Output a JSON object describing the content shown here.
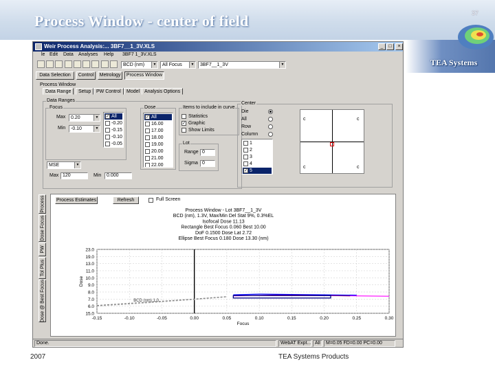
{
  "slide": {
    "title": "Process Window - center of field",
    "page_number": "37",
    "brand": "TEA Systems",
    "footer_year": "2007",
    "footer_company": "TEA Systems Products"
  },
  "window": {
    "title": "Weir Process Analysis:... 3BF7__1_3V.XLS",
    "menu": [
      "le",
      "Edit",
      "Data",
      "Analyses",
      "Help",
      "3BF7 1_3V.XLS"
    ],
    "toolbar": {
      "combo1": "BCD (nm)",
      "combo2": "All Focus",
      "combo3": "3BF7__1_3V"
    },
    "nav_buttons": [
      "Data Selection",
      "Control",
      "Metrology",
      "Process Window"
    ],
    "panel_label": "Process Window",
    "tabs": [
      "Data Range",
      "Setup",
      "PW Control",
      "Model",
      "Analysis Options"
    ],
    "data_ranges": {
      "label": "Data Ranges",
      "focus": {
        "label": "Focus",
        "max_label": "Max",
        "max_value": "0.20",
        "min_label": "Min",
        "min_value": "-0.10",
        "list": [
          "All",
          "-0.20",
          "-0.15",
          "-0.10",
          "-0.05"
        ]
      },
      "dose": {
        "label": "Dose",
        "list": [
          "All",
          "16.00",
          "17.00",
          "18.00",
          "19.00",
          "20.00",
          "21.00",
          "22.00"
        ]
      },
      "items": {
        "label": "Items to include in curve",
        "list": [
          "Statistics",
          "Graphic",
          "Show Limits"
        ]
      },
      "lot": {
        "label": "Lot",
        "range_label": "Range",
        "range_value": "0",
        "sigma_label": "Sigma",
        "sigma_value": "0"
      },
      "measure_combo": "MSE",
      "max_label": "Max",
      "max_value": "120",
      "min_label": "Min",
      "min_value": "0.000"
    },
    "center": {
      "label": "Center",
      "options": [
        "Die",
        "All",
        "Row",
        "Column"
      ],
      "list": [
        "1",
        "2",
        "3",
        "4",
        "5"
      ],
      "site_labels": [
        "c",
        "c",
        "c",
        "c"
      ]
    },
    "side_tabs": [
      "Process",
      "Dose Focus",
      "PW",
      "Tol Plus",
      "Dose @ Best Focus"
    ],
    "chart_toolbar": {
      "process_estimates": "Process Estimates",
      "refresh": "Refresh",
      "full_screen": "Full Screen"
    },
    "status": {
      "left": "Done.",
      "right1": "WebAT Expt...",
      "right2": "All",
      "right3": "M=0.05 FD=0.00 PC=0.00"
    }
  },
  "chart_data": {
    "type": "line",
    "title_lines": [
      "Process Window - Lot 3BF7__1_3V",
      "BCD (nm), 1.3V, Max/Min Del Stat 9%, 0.3%EL",
      "Isofocal Dose 11.13",
      "Rectangle Best Focus 0.060 Best 10.00",
      "DoF 0.1500 Dose Lat 2.72",
      "Ellipse Best Focus 0.180 Dose 13.30 (nm)"
    ],
    "xlabel": "Focus",
    "ylabel": "Dose",
    "x_ticks": [
      "-0.15",
      "-0.10",
      "-0.05",
      "0.00",
      "0.05",
      "0.10",
      "0.15",
      "0.20",
      "0.25",
      "0.30"
    ],
    "y_ticks": [
      "23.0",
      "19.0",
      "13.0",
      "11.0",
      "10.0",
      "9.0",
      "8.0",
      "7.0",
      "6.0",
      "15.0"
    ],
    "xlim": [
      -0.15,
      0.3
    ],
    "ylim": [
      5.0,
      23.0
    ],
    "series_annotation": "BCD (nm) 1.0",
    "series": [
      {
        "color": "#c0c0c0",
        "x": [
          -0.15,
          -0.1,
          -0.05,
          0.0,
          0.05
        ],
        "y": [
          7.0,
          7.6,
          8.2,
          8.9,
          9.6
        ]
      },
      {
        "color": "#7f7f7f",
        "x": [
          -0.15,
          -0.1,
          -0.05,
          0.0,
          0.05
        ],
        "y": [
          7.2,
          7.8,
          8.4,
          9.0,
          9.7
        ]
      },
      {
        "color": "#ff00ff",
        "x": [
          0.06,
          0.1,
          0.15,
          0.2,
          0.25,
          0.3
        ],
        "y": [
          9.9,
          10.0,
          10.0,
          10.0,
          9.9,
          9.8
        ]
      },
      {
        "color": "#0000ff",
        "x": [
          0.06,
          0.1,
          0.15,
          0.2,
          0.25
        ],
        "y": [
          10.2,
          10.4,
          10.3,
          10.2,
          10.1
        ]
      },
      {
        "color": "#800080",
        "x": [
          0.08,
          0.12,
          0.16,
          0.2,
          0.24
        ],
        "y": [
          10.0,
          10.1,
          10.1,
          10.0,
          9.9
        ]
      }
    ],
    "rectangle": {
      "x": [
        0.06,
        0.21
      ],
      "y": [
        9.3,
        10.0
      ],
      "color": "#000080"
    },
    "best_focus_line": {
      "x": 0.0,
      "color": "#000000"
    },
    "grid": true
  }
}
